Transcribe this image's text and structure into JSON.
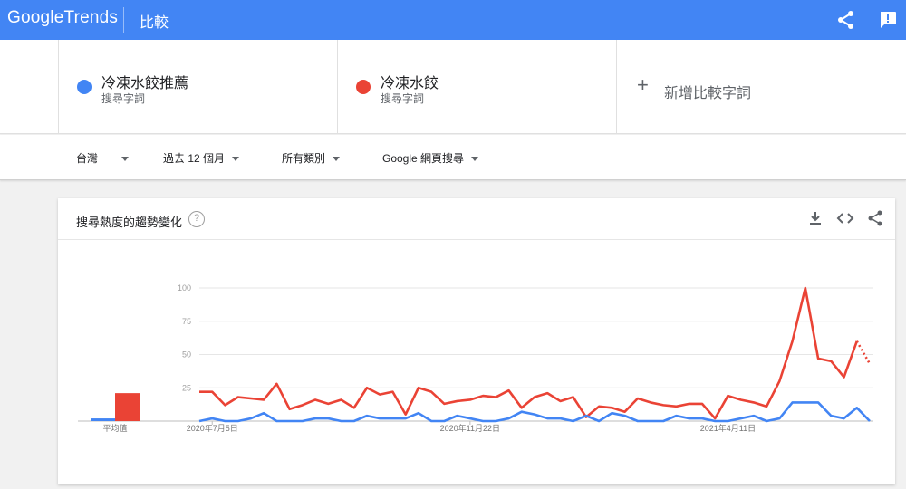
{
  "topbar": {
    "logo_google": "Google",
    "logo_trends": "Trends",
    "page_title": "比較",
    "share_icon": "share-icon",
    "feedback_icon": "feedback-icon",
    "color": "#4285f4"
  },
  "terms": [
    {
      "name": "冷凍水餃推薦",
      "sub": "搜尋字詞",
      "color": "#4285f4"
    },
    {
      "name": "冷凍水餃",
      "sub": "搜尋字詞",
      "color": "#ea4335"
    }
  ],
  "add_term": {
    "plus": "+",
    "label": "新增比較字詞"
  },
  "filters": {
    "region": "台灣",
    "time": "過去 12 個月",
    "category": "所有類別",
    "search_type": "Google 網頁搜尋"
  },
  "card": {
    "title": "搜尋熱度的趨勢變化",
    "help": "?",
    "download_icon": "download-icon",
    "embed_icon": "embed-code-icon",
    "share_icon": "share-icon"
  },
  "chart_data": {
    "type": "line",
    "title": "搜尋熱度的趨勢變化",
    "ylim": [
      0,
      100
    ],
    "yticks": [
      "100",
      "75",
      "50",
      "25"
    ],
    "xticks": [
      "2020年7月5日",
      "2020年11月22日",
      "2021年4月11日"
    ],
    "grid": true,
    "average_label": "平均值",
    "averages": [
      {
        "name": "冷凍水餃推薦",
        "value": 2,
        "color": "#4285f4"
      },
      {
        "name": "冷凍水餃",
        "value": 21,
        "color": "#ea4335"
      }
    ],
    "series": [
      {
        "name": "冷凍水餃",
        "color": "#ea4335",
        "values": [
          22,
          22,
          12,
          18,
          17,
          16,
          28,
          9,
          12,
          16,
          13,
          16,
          10,
          25,
          20,
          22,
          5,
          25,
          22,
          13,
          15,
          16,
          19,
          18,
          23,
          10,
          18,
          21,
          15,
          18,
          3,
          11,
          10,
          7,
          17,
          14,
          12,
          11,
          13,
          13,
          2,
          19,
          16,
          14,
          11,
          30,
          60,
          100,
          47,
          45,
          33,
          60,
          43
        ],
        "partial_from_index": 51
      },
      {
        "name": "冷凍水餃推薦",
        "color": "#4285f4",
        "values": [
          0,
          2,
          0,
          0,
          2,
          6,
          0,
          0,
          0,
          2,
          2,
          0,
          0,
          4,
          2,
          2,
          2,
          6,
          0,
          0,
          4,
          2,
          0,
          0,
          2,
          7,
          5,
          2,
          2,
          0,
          4,
          0,
          6,
          4,
          0,
          0,
          0,
          4,
          2,
          2,
          0,
          0,
          2,
          4,
          0,
          2,
          14,
          14,
          14,
          4,
          2,
          10,
          0
        ]
      }
    ]
  }
}
